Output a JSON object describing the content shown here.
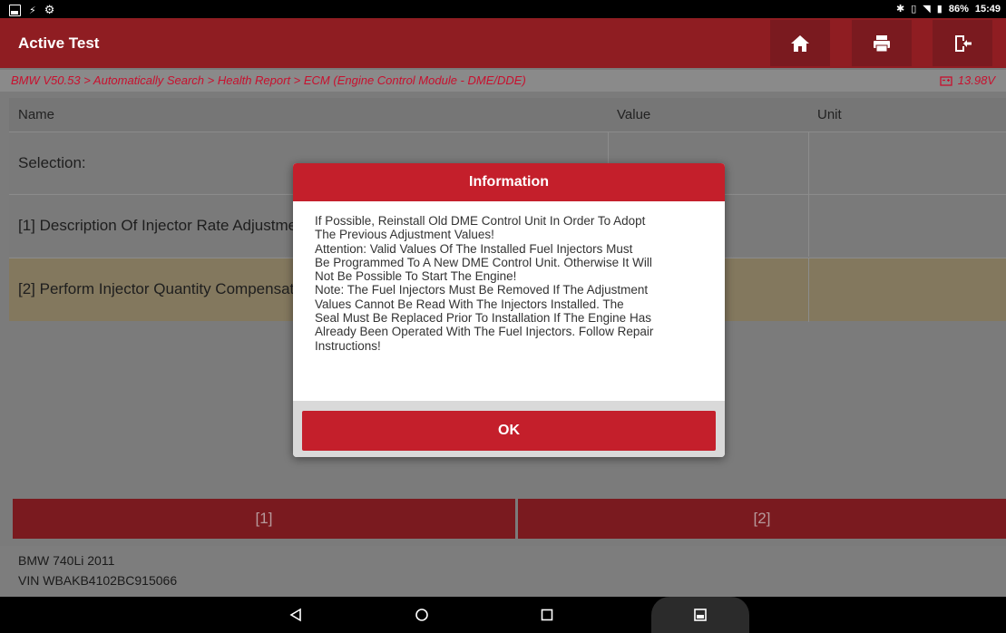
{
  "status_bar": {
    "battery": "86%",
    "time": "15:49"
  },
  "header": {
    "title": "Active Test"
  },
  "breadcrumb": "BMW V50.53 > Automatically Search > Health Report > ECM (Engine Control Module - DME/DDE)",
  "voltage": "13.98V",
  "table": {
    "columns": [
      "Name",
      "Value",
      "Unit"
    ],
    "rows": [
      {
        "name": "Selection:",
        "value": "",
        "unit": ""
      },
      {
        "name": "[1] Description Of Injector Rate Adjustment",
        "value": "",
        "unit": ""
      },
      {
        "name": "[2] Perform Injector Quantity Compensation",
        "value": "",
        "unit": ""
      }
    ]
  },
  "buttons": [
    "[1]",
    "[2]"
  ],
  "vehicle": {
    "model": "BMW 740Li 2011",
    "vin": "VIN WBAKB4102BC915066"
  },
  "dialog": {
    "title": "Information",
    "message": "If Possible, Reinstall Old DME Control Unit In Order To Adopt\nThe Previous Adjustment Values!\nAttention: Valid Values Of The Installed Fuel Injectors Must\nBe Programmed To A New DME Control Unit. Otherwise It Will\nNot Be Possible To Start The Engine!\nNote: The Fuel Injectors Must Be Removed If The Adjustment\nValues Cannot Be Read With The Injectors Installed. The\nSeal Must Be Replaced Prior To Installation If The Engine Has\nAlready Been Operated With The Fuel Injectors. Follow Repair\nInstructions!",
    "ok_label": "OK"
  },
  "colors": {
    "brand_red": "#c41f2b",
    "dim_red": "#8f1d22",
    "highlight_row": "#b9ab86"
  }
}
